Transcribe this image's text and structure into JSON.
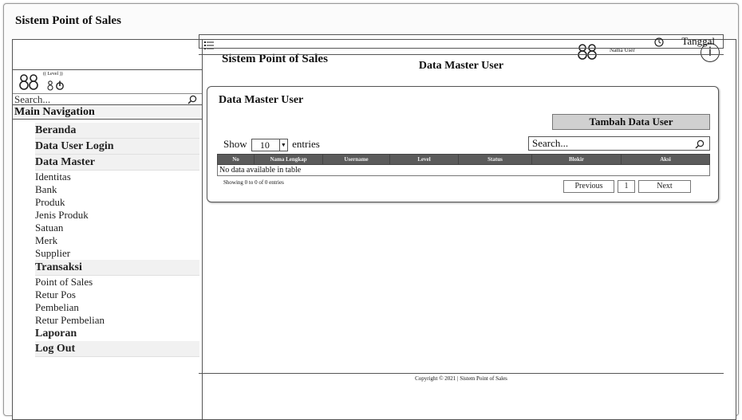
{
  "window": {
    "title": "Sistem Point of Sales"
  },
  "header": {
    "title": "Sistem Point of Sales",
    "user_name": "Nama User",
    "info_icon": "i"
  },
  "sidebar": {
    "level": "(( Level ))",
    "search_placeholder": "Search...",
    "main_nav": "Main Navigation",
    "items": [
      {
        "label": "Beranda",
        "style": "bold"
      },
      {
        "label": "Data User Login",
        "style": "bold"
      },
      {
        "label": "Data Master",
        "style": "bold"
      },
      {
        "label": "Identitas",
        "style": "normal"
      },
      {
        "label": "Bank",
        "style": "normal"
      },
      {
        "label": "Produk",
        "style": "normal"
      },
      {
        "label": "Jenis Produk",
        "style": "normal"
      },
      {
        "label": "Satuan",
        "style": "normal"
      },
      {
        "label": "Merk",
        "style": "normal"
      },
      {
        "label": "Supplier",
        "style": "normal"
      },
      {
        "label": "Transaksi",
        "style": "bold"
      },
      {
        "label": "Point of Sales",
        "style": "normal"
      },
      {
        "label": "Retur Pos",
        "style": "normal"
      },
      {
        "label": "Pembelian",
        "style": "normal"
      },
      {
        "label": "Retur Pembelian",
        "style": "normal"
      },
      {
        "label": "Laporan",
        "style": "cap"
      },
      {
        "label": "Log Out",
        "style": "bold"
      }
    ]
  },
  "datebar": {
    "label": "Tanggal"
  },
  "page": {
    "section_title": "Data Master User"
  },
  "card": {
    "title": "Data Master User",
    "add_button": "Tambah Data User",
    "show_label": "Show",
    "length_value": "10",
    "entries_label": "entries",
    "search_placeholder": "Search...",
    "columns": [
      "No",
      "Nama Lengkap",
      "Username",
      "Level",
      "Status",
      "Blokir",
      "Aksi"
    ],
    "empty_message": "No data available in table",
    "info": "Showing 0 to 0 of 0 entries",
    "pager": {
      "previous": "Previous",
      "page": "1",
      "next": "Next"
    }
  },
  "footer": {
    "text": "Copyright © 2021 | Sistem Point of Sales"
  },
  "icons": {
    "menu": "menu-icon",
    "users": "users-icon",
    "info": "info-icon",
    "clock": "clock-icon",
    "search": "search-icon"
  }
}
